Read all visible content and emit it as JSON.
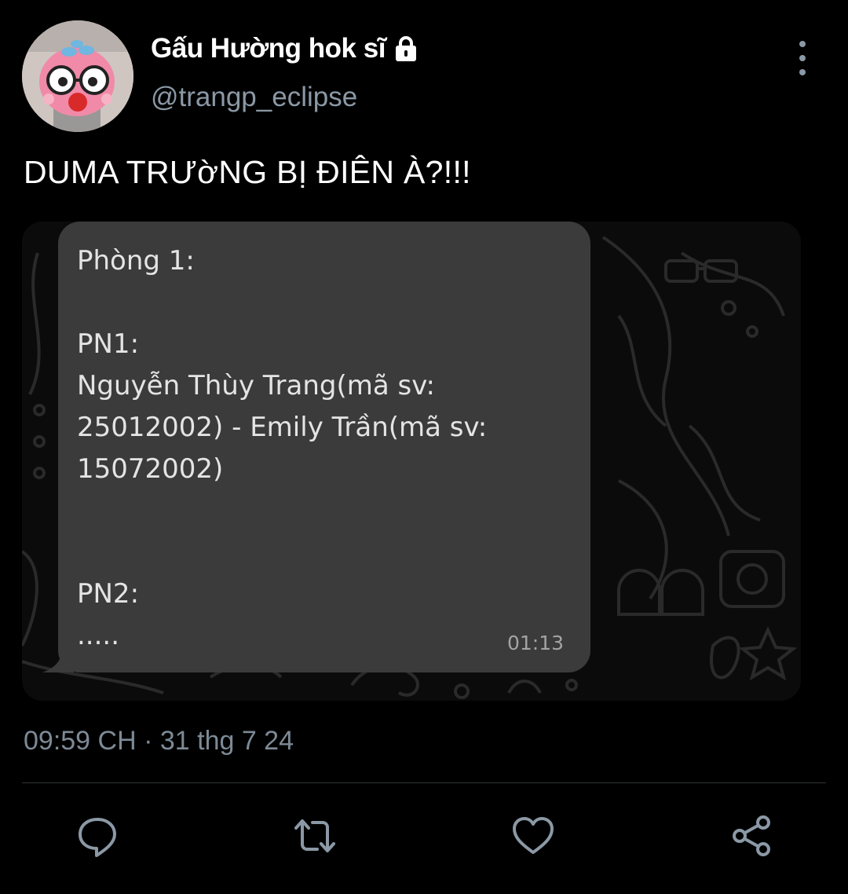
{
  "header": {
    "display_name": "Gấu Hường hok sĩ",
    "handle": "@trangp_eclipse"
  },
  "tweet": {
    "text": "DUMA TRƯờNG BỊ ĐIÊN À?!!!",
    "timestamp": "09:59 CH · 31 thg 7 24"
  },
  "media": {
    "message_lines": [
      "Phòng 1:",
      "",
      "PN1:",
      "Nguyễn Thùy Trang(mã sv:",
      "25012002) - Emily Trần(mã sv:",
      "15072002)",
      "",
      "",
      "PN2:",
      "....."
    ],
    "message_time": "01:13"
  },
  "actions": {
    "reply_icon": "reply-icon",
    "retweet_icon": "retweet-icon",
    "like_icon": "like-icon",
    "share_icon": "share-icon"
  },
  "colors": {
    "background": "#000000",
    "secondary_text": "#8b98a5",
    "bubble": "#3b3b3b"
  }
}
